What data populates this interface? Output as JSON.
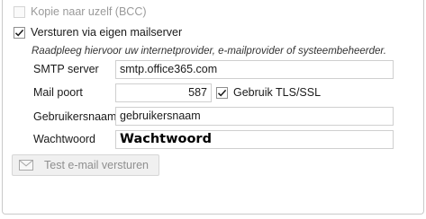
{
  "bcc": {
    "label": "Kopie naar uzelf (BCC)",
    "checked": false,
    "enabled": false
  },
  "own_server": {
    "label": "Versturen via eigen mailserver",
    "checked": true
  },
  "hint": "Raadpleeg hiervoor uw internetprovider, e-mailprovider of systeembeheerder.",
  "smtp": {
    "label": "SMTP server",
    "value": "smtp.office365.com"
  },
  "port": {
    "label": "Mail poort",
    "value": "587"
  },
  "tls": {
    "label": "Gebruik TLS/SSL",
    "checked": true
  },
  "username": {
    "label": "Gebruikersnaam",
    "value": "gebruikersnaam"
  },
  "password": {
    "label": "Wachtwoord",
    "value": "Wachtwoord"
  },
  "test_button": {
    "label": "Test e-mail versturen",
    "icon": "mail-icon",
    "enabled": false
  }
}
